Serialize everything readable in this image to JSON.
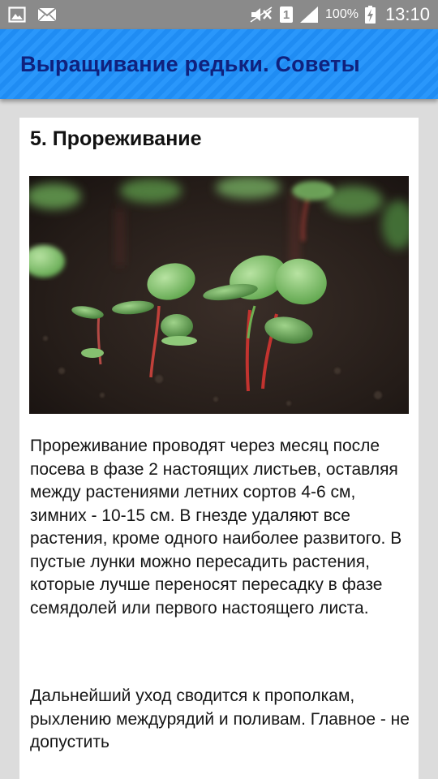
{
  "status_bar": {
    "battery_percent": "100%",
    "time": "13:10",
    "sim_slot": "1",
    "icons": [
      "gallery-icon",
      "mail-icon",
      "mute-icon",
      "sim-icon",
      "signal-icon",
      "battery-charging-icon"
    ]
  },
  "app_bar": {
    "title": "Выращивание редьки. Советы",
    "colors": {
      "background": "#1f8cf3",
      "title": "#10217d"
    }
  },
  "article": {
    "section_title": "5. Прореживание",
    "image": {
      "subject": "radish seedlings in soil"
    },
    "paragraphs": [
      "Прореживание проводят через месяц после посева в фазе 2 настоящих листьев, оставляя между растениями летних сортов 4-6 см, зимних - 10-15 см. В гнезде удаляют все растения, кроме одного наиболее развитого. В пустые лунки можно пересадить растения, которые лучше переносят пересадку в фазе семядолей или первого настоящего листа.",
      "Дальнейший уход сводится к прополкам, рыхлению междурядий и поливам. Главное - не допустить"
    ]
  }
}
